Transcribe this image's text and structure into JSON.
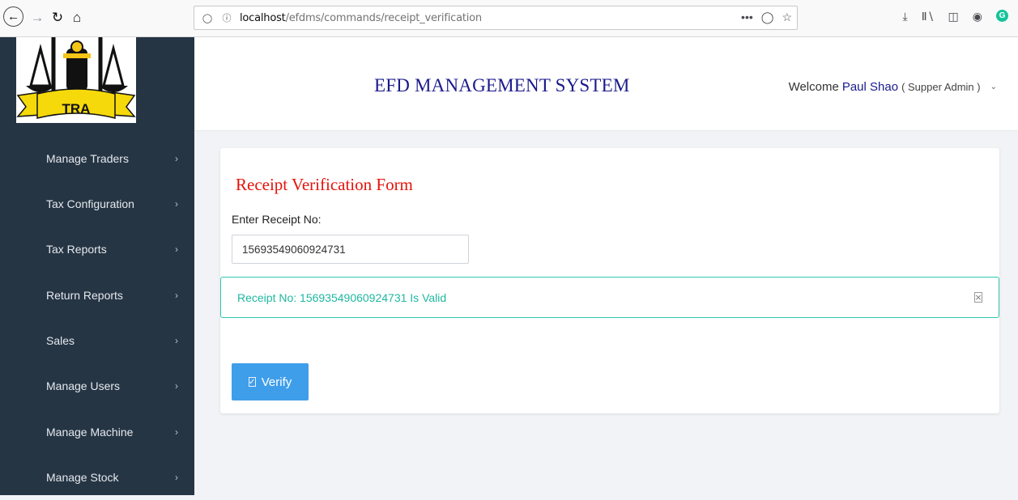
{
  "browser": {
    "url_host": "localhost",
    "url_path": "/efdms/commands/receipt_verification",
    "page_actions": "•••"
  },
  "header": {
    "title": "EFD MANAGEMENT SYSTEM",
    "welcome_prefix": "Welcome",
    "user_name": "Paul Shao",
    "role": "( Supper Admin )"
  },
  "logo": {
    "text": "TRA"
  },
  "sidebar": {
    "items": [
      {
        "label": "Manage Traders"
      },
      {
        "label": "Tax Configuration"
      },
      {
        "label": "Tax Reports"
      },
      {
        "label": "Return Reports"
      },
      {
        "label": "Sales"
      },
      {
        "label": "Manage Users"
      },
      {
        "label": "Manage Machine"
      },
      {
        "label": "Manage Stock"
      }
    ]
  },
  "form": {
    "title": "Receipt Verification Form",
    "label": "Enter Receipt No:",
    "receipt_value": "15693549060924731",
    "alert_message": "Receipt No: 15693549060924731 Is Valid",
    "verify_label": "Verify"
  },
  "colors": {
    "sidebar_bg": "#263544",
    "title_red": "#e4130b",
    "brand_navy": "#1a1a8c",
    "alert_teal": "#2fc7b1",
    "button_blue": "#3f9eea"
  }
}
